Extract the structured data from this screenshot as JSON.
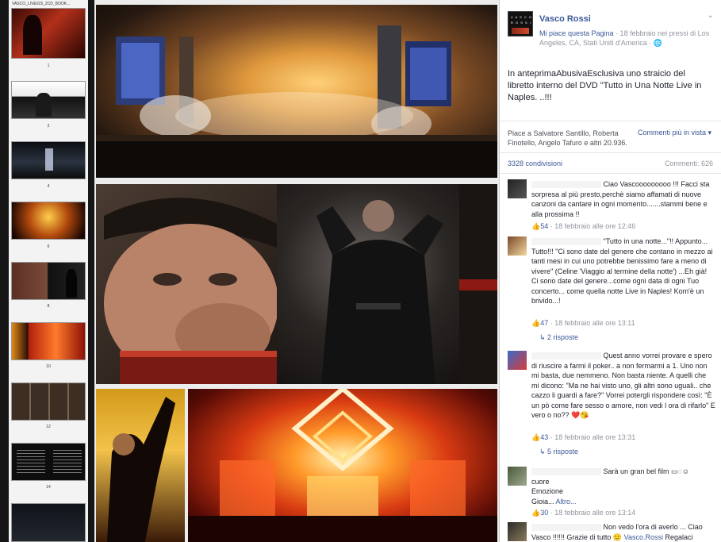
{
  "thumbnails": {
    "title": "VASCO_LIVE015_2CD_BOOK...",
    "page_numbers": [
      "1",
      "2",
      "4",
      "6",
      "8",
      "10",
      "12",
      "14"
    ]
  },
  "post": {
    "page_name": "Vasco Rossi",
    "avatar_text": [
      "V A S C O",
      "R O S S I"
    ],
    "like_page": "Mi piace questa Pagina",
    "meta": " · 18 febbraio nei pressi di Los Angeles, CA, Stati Uniti d'America · ",
    "globe": "🌐",
    "chevron": "⌄",
    "text": "In anteprimaAbusivaEsclusiva uno straicio del libretto interno del DVD \"Tutto in Una Notte Live in Naples. ..!!!",
    "likes_text": "Piace a Salvatore Santillo, Roberta Finotello, Angelo Tafuro e altri 20.936.",
    "more_comments": "Commenti più in vista ▾",
    "shares": "3328 condivisioni",
    "comments_count": "Commenti: 626"
  },
  "comments": [
    {
      "text": " Ciao Vascooooooooo !!! Facci sta sorpresa al più presto,perchè siamo affamati di nuove canzoni da cantare in ogni momento.......stammi bene e alla prossima !!",
      "likes": "54",
      "time": " · 18 febbraio alle ore 12:46"
    },
    {
      "text": " \"Tutto in una notte...\"!! Appunto... Tutto!!! \"Ci sono date del genere che contano in mezzo ai tanti mesi in cui uno potrebbe benissimo fare a meno di vivere\" (Celine 'Viaggio al termine della notte') ...Eh già! Ci sono date del genere...come ogni data di ogni Tuo concerto... come quella notte Live in Naples! Kom'è un brivido...!",
      "likes": "47",
      "time": " · 18 febbraio alle ore 13:11",
      "replies": "2 risposte"
    },
    {
      "text": " Quest anno vorrei provare e spero di riuscire a farmi il poker.. a non fermarmi a 1. Uno non mi basta, due nemmeno. Non basta niente. A quelli che mi dicono: \"Ma ne hai visto uno, gli altri sono uguali.. che cazzo li guardi a fare?\" Vorrei potergli rispondere così: \"È un pò come fare sesso o amore, non vedi l ora di rifarlo\" E vero o no?? ",
      "emoji": "❤️😘",
      "likes": "43",
      "time": " · 18 febbraio alle ore 13:31",
      "replies": "5 risposte"
    },
    {
      "text": " Sarà un gran bel film ",
      "tail": "cuore",
      "line2": "Emozione",
      "line3": "Gioia...",
      "more": " Altro...",
      "likes": "30",
      "time": " · 18 febbraio alle ore 13:14"
    },
    {
      "text": " Non vedo l'ora di averlo ... Ciao Vasco !!!!!! Grazie di tutto ",
      "emoji": "🙂",
      "mention": "Vasco.Rossi",
      "end": " Regalaci"
    }
  ],
  "colors": {
    "link": "#3b5998",
    "meta": "#90949c",
    "text": "#1d2129"
  }
}
